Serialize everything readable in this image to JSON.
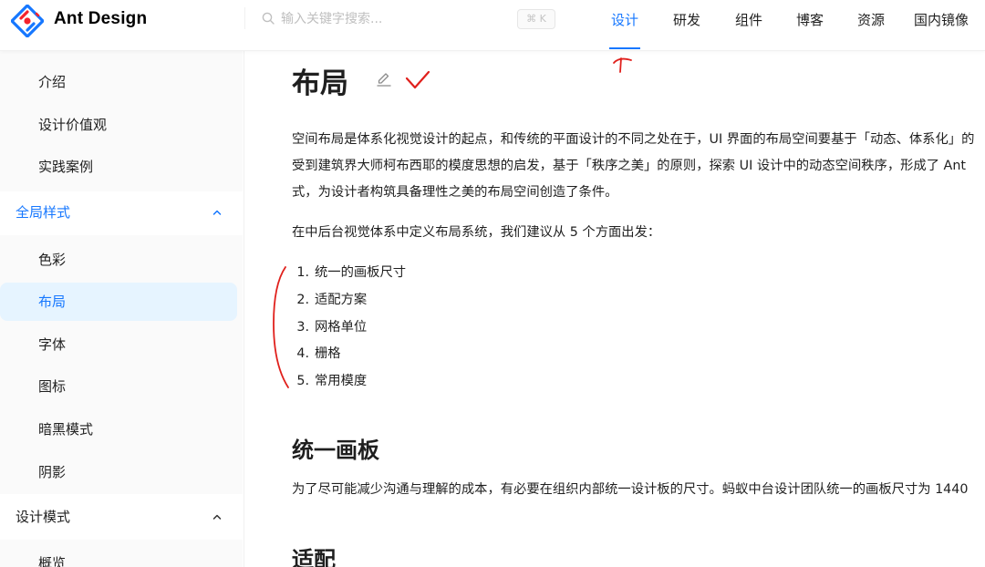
{
  "header": {
    "brand": "Ant Design",
    "search": {
      "placeholder": "输入关键字搜索...",
      "shortcut": "⌘ K"
    },
    "nav": [
      {
        "label": "设计",
        "active": true
      },
      {
        "label": "研发",
        "active": false
      },
      {
        "label": "组件",
        "active": false
      },
      {
        "label": "博客",
        "active": false
      },
      {
        "label": "资源",
        "active": false
      },
      {
        "label": "国内镜像",
        "active": false
      }
    ]
  },
  "sidebar": {
    "items_top": [
      "介绍",
      "设计价值观",
      "实践案例"
    ],
    "group_global": {
      "label": "全局样式",
      "expanded": true
    },
    "global_items": [
      "色彩",
      "布局",
      "字体",
      "图标",
      "暗黑模式",
      "阴影"
    ],
    "selected_item": "布局",
    "group_patterns": {
      "label": "设计模式",
      "expanded": true
    },
    "pattern_items": [
      "概览"
    ]
  },
  "content": {
    "title": "布局",
    "intro_lines": [
      "空间布局是体系化视觉设计的起点，和传统的平面设计的不同之处在于，UI 界面的布局空间要基于「动态、体系化」的",
      "受到建筑界大师柯布西耶的模度思想的启发，基于「秩序之美」的原则，探索 UI 设计中的动态空间秩序，形成了 Ant",
      "式，为设计者构筑具备理性之美的布局空间创造了条件。"
    ],
    "list_intro": "在中后台视觉体系中定义布局系统，我们建议从 5 个方面出发：",
    "list": [
      {
        "num": "1.",
        "text": "统一的画板尺寸"
      },
      {
        "num": "2.",
        "text": "适配方案"
      },
      {
        "num": "3.",
        "text": "网格单位"
      },
      {
        "num": "4.",
        "text": "栅格"
      },
      {
        "num": "5.",
        "text": "常用模度"
      }
    ],
    "section1": {
      "heading": "统一画板",
      "text": "为了尽可能减少沟通与理解的成本，有必要在组织内部统一设计板的尺寸。蚂蚁中台设计团队统一的画板尺寸为 1440"
    },
    "section2": {
      "heading": "适配"
    }
  },
  "colors": {
    "primary": "#1677ff",
    "selected_bg": "#e6f4ff",
    "annotation": "#e0201c",
    "logo_red": "#f5222d",
    "logo_blue": "#1677ff"
  },
  "icons": [
    "ant-design-logo",
    "search-icon",
    "chevron-up-icon",
    "edit-icon"
  ]
}
